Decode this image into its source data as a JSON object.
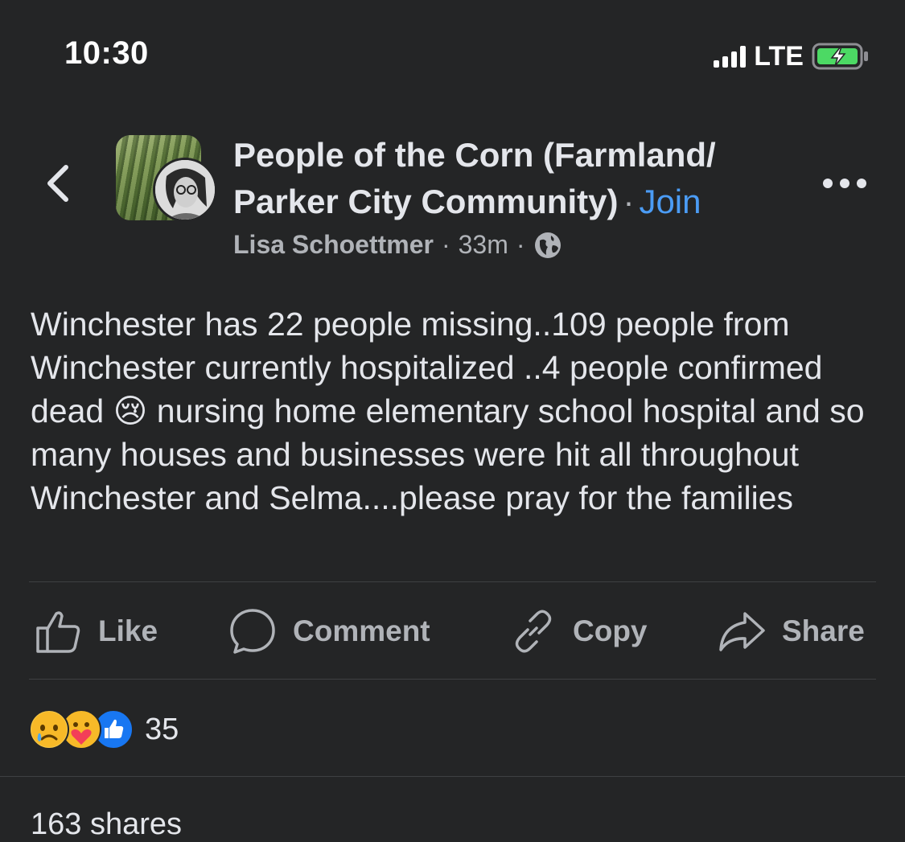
{
  "status_bar": {
    "time": "10:30",
    "network": "LTE",
    "battery_state": "charging",
    "battery_color": "#4cd964"
  },
  "header": {
    "back_icon": "chevron-left-icon",
    "group_name": "People of the Corn (Farmland/ Parker City Community)",
    "separator": "·",
    "join_label": "Join",
    "author": "Lisa Schoettmer",
    "time_ago": "33m",
    "privacy_icon": "globe-icon",
    "more_icon": "more-horizontal-icon"
  },
  "post": {
    "text_before_emoji": "Winchester has 22 people missing..109 people from Winchester currently hospitalized ..4 people confirmed dead",
    "emoji": "😢",
    "text_after_emoji": "nursing home elementary school hospital and so many houses and businesses were hit all throughout Winchester and Selma....please pray for the families"
  },
  "actions": [
    {
      "label": "Like",
      "icon": "thumbs-up-icon"
    },
    {
      "label": "Comment",
      "icon": "comment-bubble-icon"
    },
    {
      "label": "Copy",
      "icon": "link-icon"
    },
    {
      "label": "Share",
      "icon": "share-arrow-icon"
    }
  ],
  "reactions": {
    "icons": [
      "sad-reaction",
      "care-reaction",
      "like-reaction"
    ],
    "like_color": "#1877f2",
    "count": "35"
  },
  "shares": "163 shares",
  "colors": {
    "background": "#242526",
    "text": "#e4e6eb",
    "muted": "#b0b3b8",
    "link": "#4b9cf5"
  }
}
